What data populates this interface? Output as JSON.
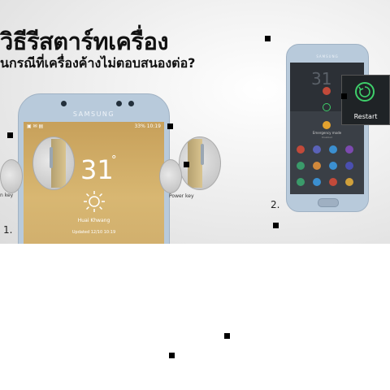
{
  "header": {
    "title": "วิธีรีสตาร์ทเครื่อง",
    "subtitle": "นกรณีที่เครื่องค้างไม่ตอบสนองต่อ?"
  },
  "phone1": {
    "brand": "SAMSUNG",
    "status_right": "33% 10:19",
    "time": "31",
    "degree": "°",
    "location": "Huai Khwang",
    "updated": "Updated 12/10 10:19",
    "step_number": "1.",
    "left_label": "n key",
    "right_label": "Power key"
  },
  "phone2": {
    "brand": "SAMSUNG",
    "step_number": "2.",
    "restart_label": "Restart",
    "emergency_label": "Emergency mode",
    "emergency_sub": "Disabled"
  }
}
